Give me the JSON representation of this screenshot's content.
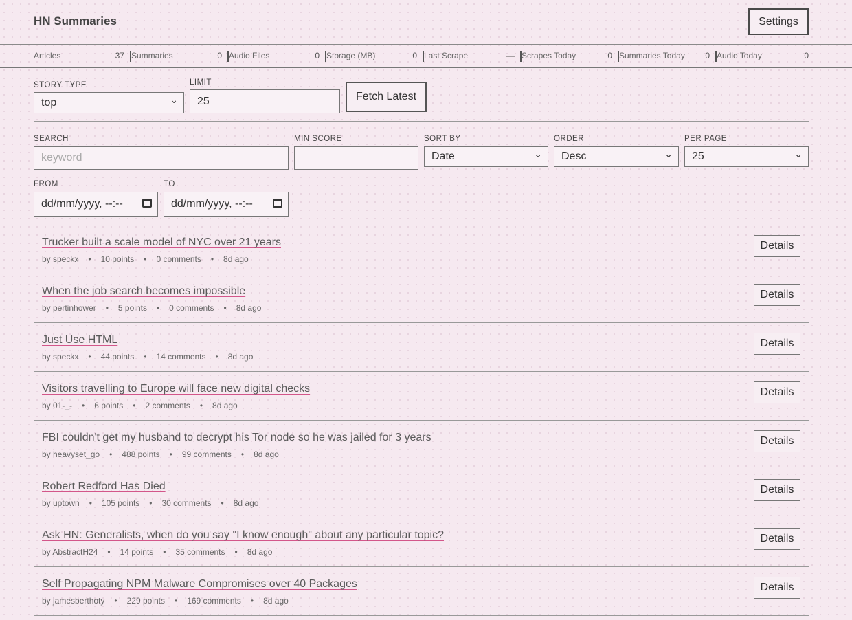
{
  "header": {
    "title": "HN Summaries",
    "settings_label": "Settings"
  },
  "stats": [
    {
      "label": "Articles",
      "value": "37"
    },
    {
      "label": "Summaries",
      "value": "0"
    },
    {
      "label": "Audio Files",
      "value": "0"
    },
    {
      "label": "Storage (MB)",
      "value": "0"
    },
    {
      "label": "Last Scrape",
      "value": "—"
    },
    {
      "label": "Scrapes Today",
      "value": "0"
    },
    {
      "label": "Summaries Today",
      "value": "0"
    },
    {
      "label": "Audio Today",
      "value": "0"
    }
  ],
  "fetch": {
    "story_type_label": "STORY TYPE",
    "story_type_value": "top",
    "limit_label": "LIMIT",
    "limit_value": "25",
    "button_label": "Fetch Latest"
  },
  "filters": {
    "search_label": "SEARCH",
    "search_placeholder": "keyword",
    "min_score_label": "MIN SCORE",
    "min_score_value": "",
    "sort_by_label": "SORT BY",
    "sort_by_value": "Date",
    "order_label": "ORDER",
    "order_value": "Desc",
    "per_page_label": "PER PAGE",
    "per_page_value": "25",
    "from_label": "FROM",
    "from_value": "dd/mm/yyyy, --:--",
    "to_label": "TO",
    "to_value": "dd/mm/yyyy, --:--"
  },
  "stories": [
    {
      "title": "Trucker built a scale model of NYC over 21 years",
      "by": "by speckx",
      "points": "10 points",
      "comments": "0 comments",
      "age": "8d ago",
      "details": "Details"
    },
    {
      "title": "When the job search becomes impossible",
      "by": "by pertinhower",
      "points": "5 points",
      "comments": "0 comments",
      "age": "8d ago",
      "details": "Details"
    },
    {
      "title": "Just Use HTML",
      "by": "by speckx",
      "points": "44 points",
      "comments": "14 comments",
      "age": "8d ago",
      "details": "Details"
    },
    {
      "title": "Visitors travelling to Europe will face new digital checks",
      "by": "by 01-_-",
      "points": "6 points",
      "comments": "2 comments",
      "age": "8d ago",
      "details": "Details"
    },
    {
      "title": "FBI couldn't get my husband to decrypt his Tor node so he was jailed for 3 years",
      "by": "by heavyset_go",
      "points": "488 points",
      "comments": "99 comments",
      "age": "8d ago",
      "details": "Details"
    },
    {
      "title": "Robert Redford Has Died",
      "by": "by uptown",
      "points": "105 points",
      "comments": "30 comments",
      "age": "8d ago",
      "details": "Details"
    },
    {
      "title": "Ask HN: Generalists, when do you say \"I know enough\" about any particular topic?",
      "by": "by AbstractH24",
      "points": "14 points",
      "comments": "35 comments",
      "age": "8d ago",
      "details": "Details"
    },
    {
      "title": "Self Propagating NPM Malware Compromises over 40 Packages",
      "by": "by jamesberthoty",
      "points": "229 points",
      "comments": "169 comments",
      "age": "8d ago",
      "details": "Details"
    }
  ],
  "meta_separator": "•"
}
